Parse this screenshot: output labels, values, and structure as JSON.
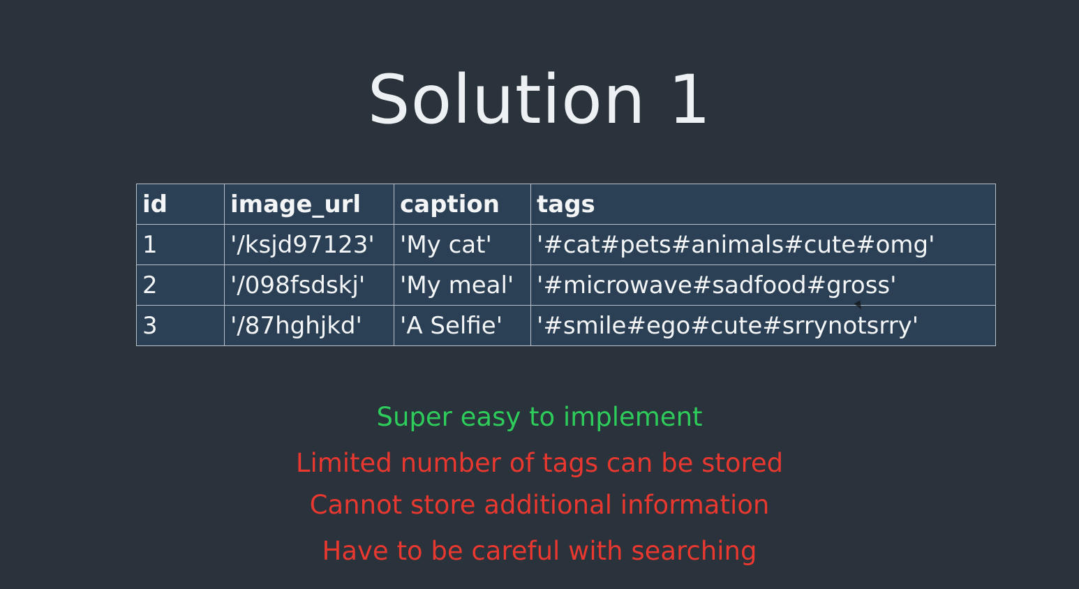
{
  "slide": {
    "title": "Solution 1"
  },
  "table": {
    "headers": [
      "id",
      "image_url",
      "caption",
      "tags"
    ],
    "rows": [
      [
        "1",
        "'/ksjd97123'",
        "'My cat'",
        "'#cat#pets#animals#cute#omg'"
      ],
      [
        "2",
        "'/098fsdskj'",
        "'My meal'",
        "'#microwave#sadfood#gross'"
      ],
      [
        "3",
        "'/87hghjkd'",
        "'A Selfie'",
        "'#smile#ego#cute#srrynotsrry'"
      ]
    ]
  },
  "notes": {
    "pro": "Super easy to implement",
    "cons": [
      "Limited number of tags can be stored",
      "Cannot store additional information",
      "Have to be careful with searching"
    ]
  },
  "colors": {
    "background": "#2a323b",
    "table_fill": "#2b4055",
    "pro": "#2ecc5a",
    "con": "#e8382f"
  },
  "icons": {
    "cursor": "mouse-pointer-icon"
  }
}
